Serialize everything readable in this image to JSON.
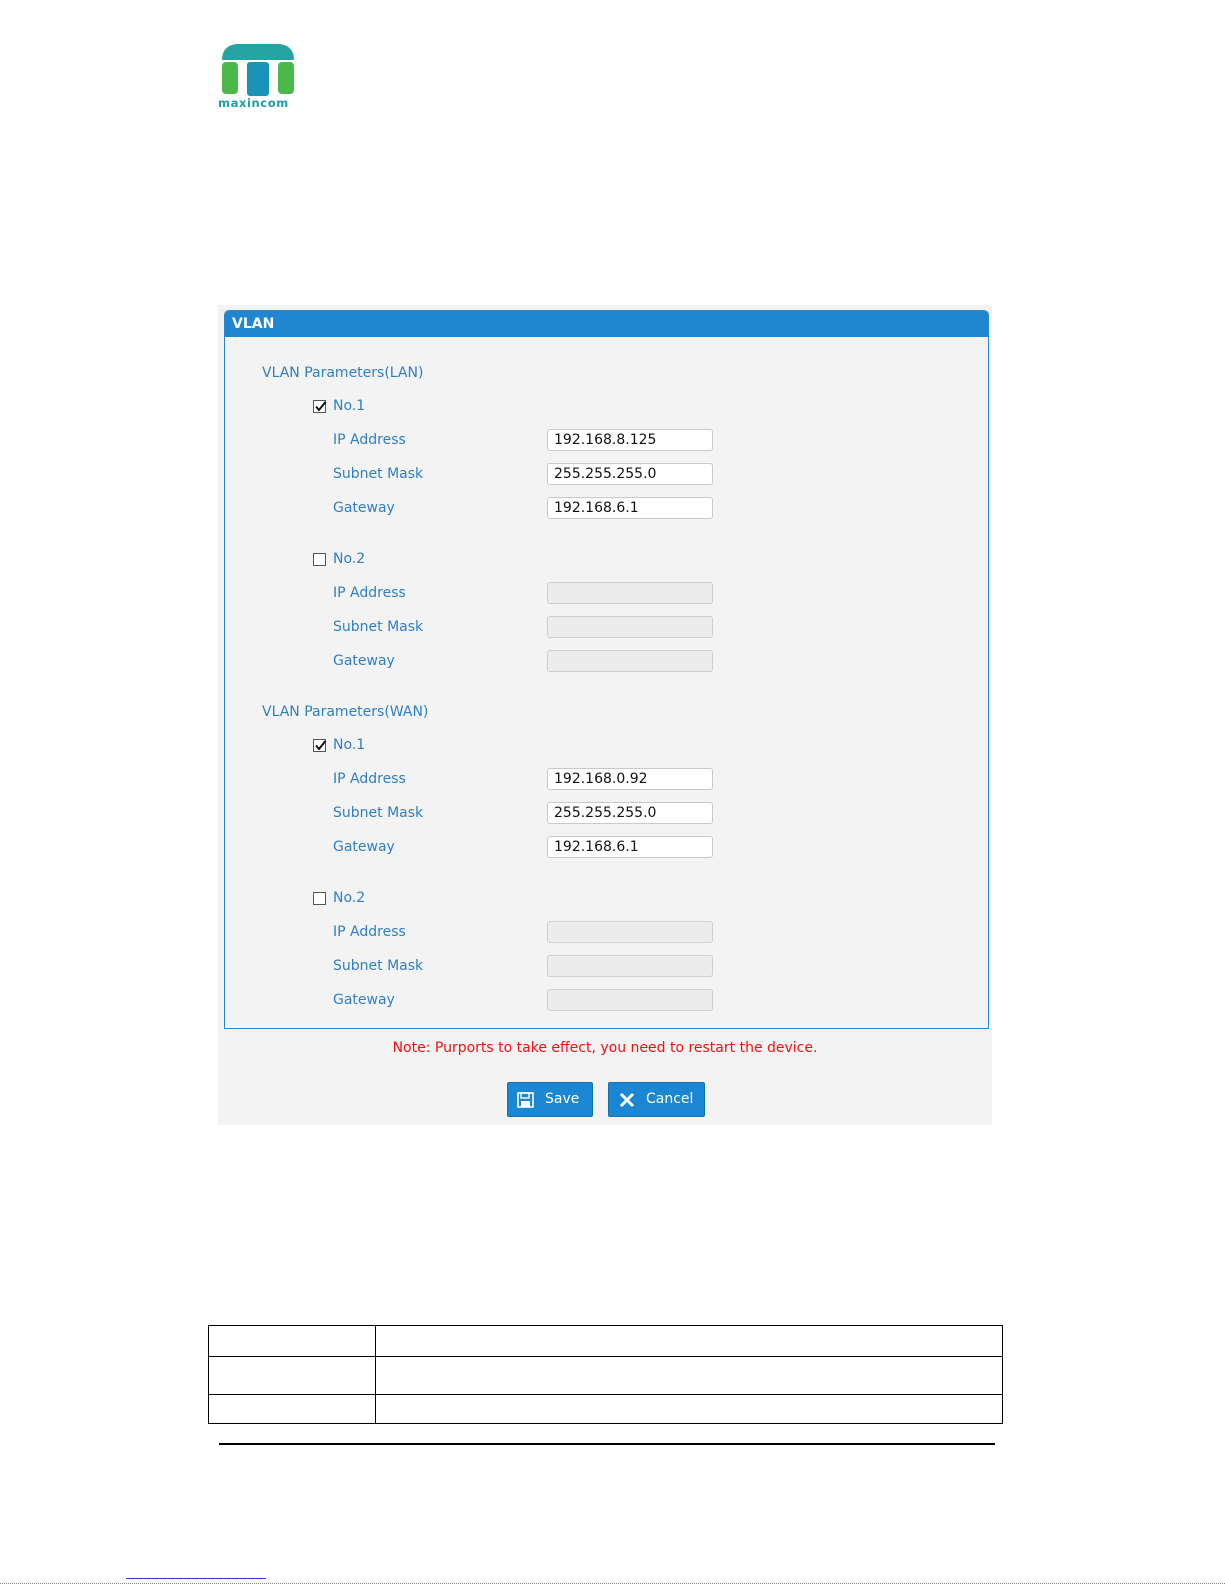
{
  "logo": {
    "text": "maxincom",
    "color": "#1a9eb0"
  },
  "panel": {
    "title": "VLAN"
  },
  "sections": [
    {
      "title": "VLAN Parameters(LAN)",
      "entries": [
        {
          "label": "No.1",
          "checked": true,
          "ip_label": "IP Address",
          "mask_label": "Subnet Mask",
          "gw_label": "Gateway",
          "ip": "192.168.8.125",
          "mask": "255.255.255.0",
          "gateway": "192.168.6.1"
        },
        {
          "label": "No.2",
          "checked": false,
          "ip_label": "IP Address",
          "mask_label": "Subnet Mask",
          "gw_label": "Gateway",
          "ip": "",
          "mask": "",
          "gateway": ""
        }
      ]
    },
    {
      "title": "VLAN Parameters(WAN)",
      "entries": [
        {
          "label": "No.1",
          "checked": true,
          "ip_label": "IP Address",
          "mask_label": "Subnet Mask",
          "gw_label": "Gateway",
          "ip": "192.168.0.92",
          "mask": "255.255.255.0",
          "gateway": "192.168.6.1"
        },
        {
          "label": "No.2",
          "checked": false,
          "ip_label": "IP Address",
          "mask_label": "Subnet Mask",
          "gw_label": "Gateway",
          "ip": "",
          "mask": "",
          "gateway": ""
        }
      ]
    }
  ],
  "note": "Note: Purports to take effect, you need to restart the device.",
  "buttons": {
    "save": "Save",
    "cancel": "Cancel"
  },
  "colors": {
    "accent": "#1f86cf",
    "label": "#2f7fc3",
    "note": "#f01010"
  }
}
